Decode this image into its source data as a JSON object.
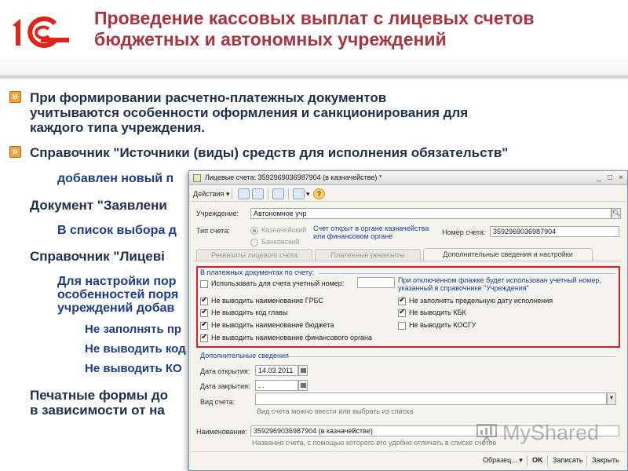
{
  "slide": {
    "title": "Проведение кассовых выплат с лицевых счетов бюджетных и автономных учреждений",
    "brand_color": "#a9343f",
    "bullets": [
      {
        "text": "При формировании расчетно-платежных документов учитываются особенности оформления и санкционирования для каждого типа учреждения."
      },
      {
        "text": "Справочник \"Источники (виды) средств для исполнения обязательств\"",
        "sub": [
          "добавлен новый п"
        ]
      },
      {
        "text": "Документ \"Заявлени",
        "sub": [
          "В список выбора д"
        ]
      },
      {
        "text": "Справочник \"Лицеві",
        "sub": [
          "Для настройки пор",
          "особенностей поря",
          "учреждений добав"
        ],
        "items": [
          "Не заполнять пр",
          "Не выводить код",
          "Не выводить КО"
        ]
      },
      {
        "text": "Печатные формы до",
        "cont": "в зависимости от на"
      }
    ]
  },
  "window": {
    "title": "Лицевые счета: 3592969036987904 (в казначействе) *",
    "toolbar": {
      "actions": "Действия",
      "help": "?"
    },
    "institution_label": "Учреждение:",
    "institution_value": "Автономное учр",
    "account_type_label": "Тип счета:",
    "radio_treasury": "Казначейский",
    "radio_bank": "Банковский",
    "account_note": "Счет открыт в органе казначейства или финансовом органе",
    "account_number_label": "Номер счета:",
    "account_number_value": "3592969036987904",
    "tabs": [
      "Реквизиты лицевого счета",
      "Платежные реквизиты",
      "Дополнительные сведения и настройки"
    ],
    "payment_group": "В платежных документах по счету:",
    "use_number_label": "Использовать для счета учетный номер:",
    "flag_note": "При отключенном флажке будет использован учетный номер, указанный в справочнике \"Учреждения\"",
    "checks_left": [
      "Не выводить наименование ГРБС",
      "Не выводить код главы",
      "Не выводить наименование бюджета",
      "Не выводить наименование финансового органа"
    ],
    "checks_right": [
      "Не заполнять предельную дату исполнения",
      "Не выводить КБК",
      "Не выводить КОСГУ"
    ],
    "extra_group": "Дополнительные сведения",
    "open_date_label": "Дата открытия:",
    "open_date_value": "14.03.2011",
    "close_date_label": "Дата закрытия:",
    "close_date_value": " .  .",
    "account_kind_label": "Вид счета:",
    "account_kind_hint": "Вид счета можно ввести или выбрать из списка",
    "name_label": "Наименование:",
    "name_value": "3592969036987904 (в казначействе)",
    "name_hint": "Название счета, с помощью которого его удобно отличать в списке счетов",
    "bottom": {
      "sample": "Образец...",
      "ok": "OK",
      "save": "Записать",
      "close": "Закрыть"
    }
  },
  "watermark": {
    "text": "MyShared"
  }
}
